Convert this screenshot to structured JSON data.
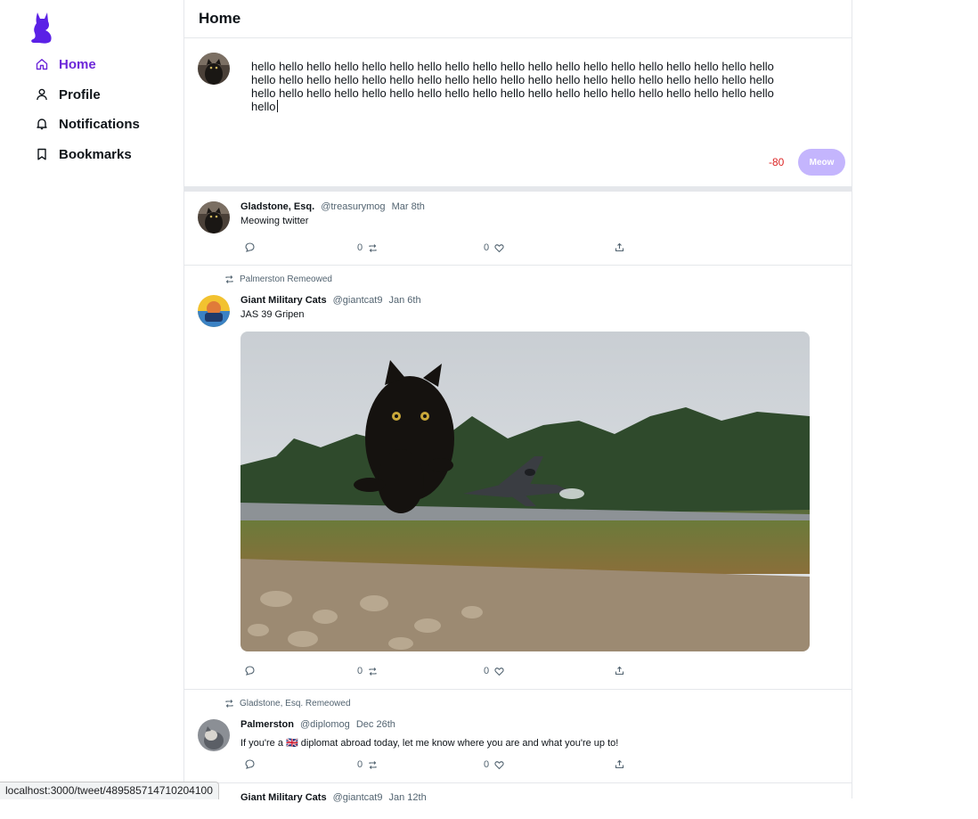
{
  "sidebar": {
    "items": [
      {
        "label": "Home",
        "icon": "home-icon",
        "active": true
      },
      {
        "label": "Profile",
        "icon": "person-icon"
      },
      {
        "label": "Notifications",
        "icon": "bell-icon"
      },
      {
        "label": "Bookmarks",
        "icon": "bookmark-icon"
      }
    ]
  },
  "header": {
    "title": "Home"
  },
  "composer": {
    "text": "hello hello hello hello hello hello hello hello hello hello hello hello hello hello hello hello hello hello hello hello hello hello hello hello hello hello hello hello hello hello hello hello hello hello hello hello hello hello hello hello hello hello hello hello hello hello hello hello hello hello hello hello hello hello hello hello hello hello",
    "char_count": "-80",
    "submit_label": "Meow"
  },
  "tweets": [
    {
      "name": "Gladstone, Esq.",
      "handle": "@treasurymog",
      "date": "Mar 8th",
      "text": "Meowing twitter",
      "remeows": "0",
      "likes": "0"
    },
    {
      "remeowed_by": "Palmerston Remeowed",
      "name": "Giant Military Cats",
      "handle": "@giantcat9",
      "date": "Jan 6th",
      "text": "JAS 39 Gripen",
      "remeows": "0",
      "likes": "0"
    },
    {
      "remeowed_by": "Gladstone, Esq. Remeowed",
      "name": "Palmerston",
      "handle": "@diplomog",
      "date": "Dec 26th",
      "text": "If you're a 🇬🇧 diplomat abroad today, let me know where you are and what you're up to!",
      "remeows": "0",
      "likes": "0"
    },
    {
      "name": "Giant Military Cats",
      "handle": "@giantcat9",
      "date": "Jan 12th"
    }
  ],
  "status_bar": {
    "url": "localhost:3000/tweet/489585714710204100"
  },
  "colors": {
    "accent": "#6d28d9",
    "button": "#c4b5fd",
    "danger": "#dc2626"
  }
}
